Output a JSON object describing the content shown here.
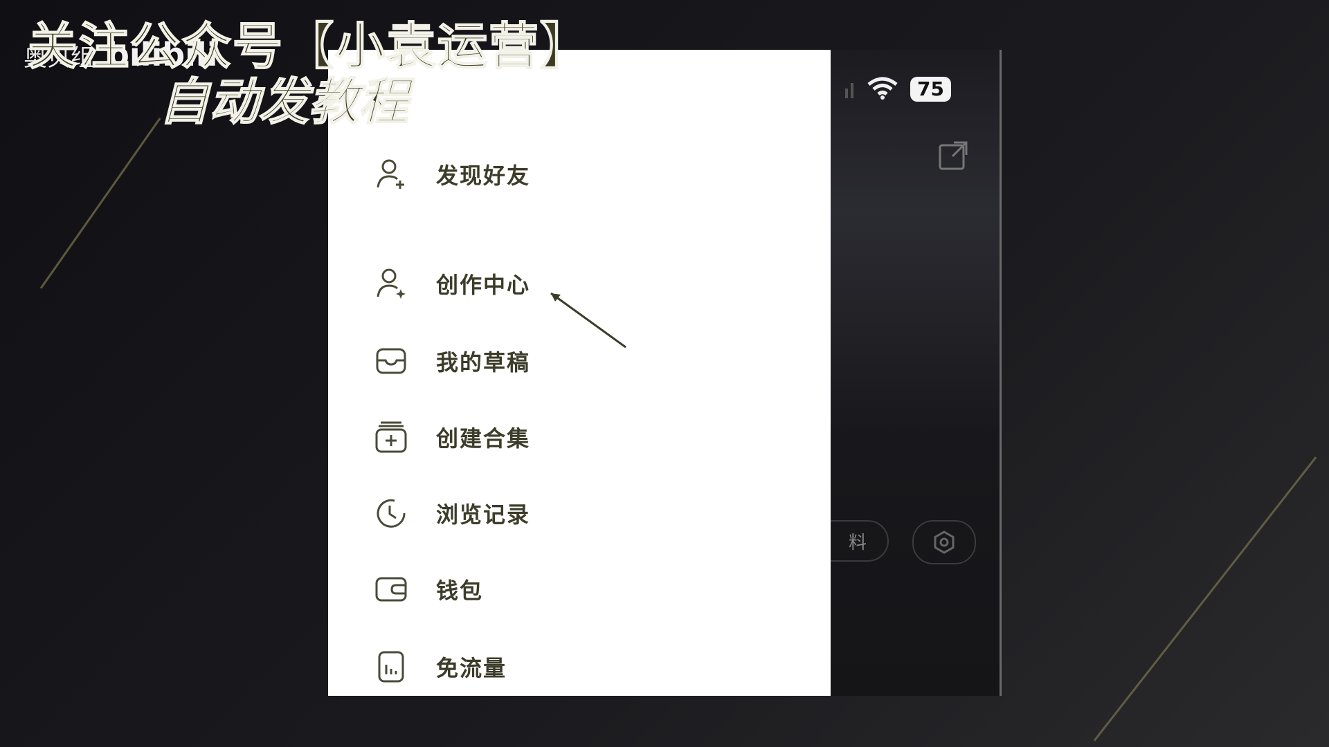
{
  "overlay": {
    "title": "关注公众号【小袁运营】",
    "subtitle": "自动发教程",
    "watermark_text": "奥贝组",
    "watermark_logo": "bilibili"
  },
  "status_bar": {
    "signal_icon": "signal-icon",
    "wifi_icon": "wifi-icon",
    "battery": "75"
  },
  "background_ui": {
    "share_icon": "share-icon",
    "edit_profile_label": "料",
    "settings_icon": "gear-icon"
  },
  "drawer": {
    "items": [
      {
        "label": "发现好友",
        "icon": "add-friend-icon"
      },
      {
        "label": "创作中心",
        "icon": "creator-icon"
      },
      {
        "label": "我的草稿",
        "icon": "drafts-icon"
      },
      {
        "label": "创建合集",
        "icon": "collection-add-icon"
      },
      {
        "label": "浏览记录",
        "icon": "history-icon"
      },
      {
        "label": "钱包",
        "icon": "wallet-icon"
      },
      {
        "label": "免流量",
        "icon": "data-free-icon"
      }
    ]
  },
  "colors": {
    "drawer_bg": "#ffffff",
    "text": "#3c3c2a",
    "icon": "#4a4a38",
    "accent_overlay": "#3c3a24"
  }
}
